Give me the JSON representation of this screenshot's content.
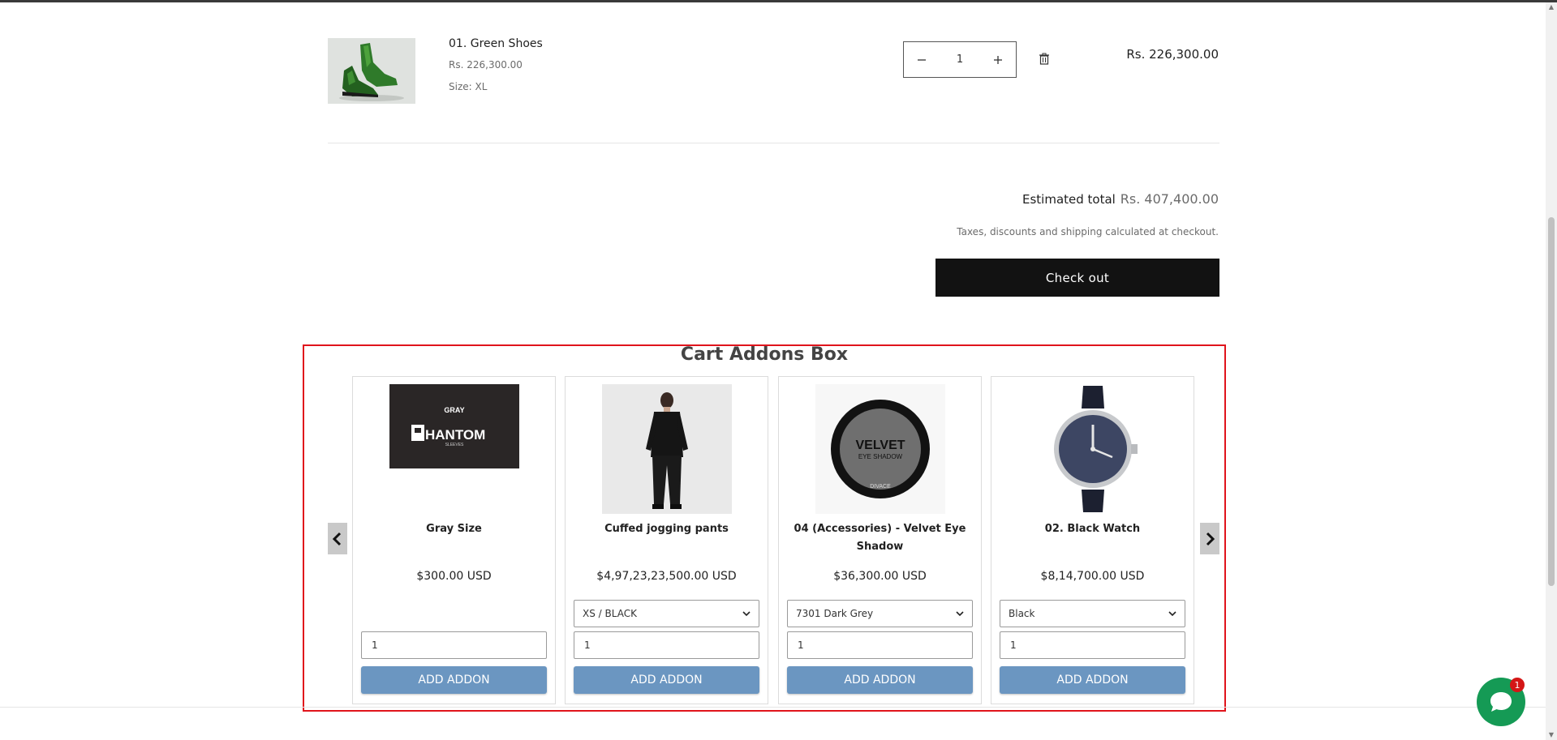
{
  "cart_item": {
    "name": "01. Green Shoes",
    "price": "Rs. 226,300.00",
    "size": "Size: XL",
    "quantity": "1",
    "line_total": "Rs. 226,300.00",
    "decrease_icon": "minus-icon",
    "increase_icon": "plus-icon",
    "remove_icon": "trash-icon"
  },
  "summary": {
    "estimated_label": "Estimated total",
    "estimated_value": "Rs. 407,400.00",
    "tax_note": "Taxes, discounts and shipping calculated at checkout.",
    "checkout_label": "Check out"
  },
  "addons": {
    "title": "Cart Addons Box",
    "border_color": "#e0141c",
    "button_color": "#6b96c1",
    "prev_icon": "chevron-left-icon",
    "next_icon": "chevron-right-icon",
    "cards": [
      {
        "title": "Gray Size",
        "price": "$300.00 USD",
        "variant": "",
        "quantity": "1",
        "button": "ADD ADDON",
        "logo_top": "GRAY",
        "logo_main": "HANTOM",
        "logo_sub": "SLEEVES"
      },
      {
        "title": "Cuffed jogging pants",
        "price": "$4,97,23,23,500.00 USD",
        "variant": "XS / BLACK",
        "quantity": "1",
        "button": "ADD ADDON"
      },
      {
        "title": "04 (Accessories) - Velvet Eye Shadow",
        "price": "$36,300.00 USD",
        "variant": "7301 Dark Grey",
        "quantity": "1",
        "button": "ADD ADDON",
        "label_main": "VELVET",
        "label_sub": "EYE SHADOW",
        "label_brand": "DIVACE"
      },
      {
        "title": "02. Black Watch",
        "price": "$8,14,700.00 USD",
        "variant": "Black",
        "quantity": "1",
        "button": "ADD ADDON"
      }
    ]
  },
  "chat": {
    "icon": "chat-bubble-icon",
    "badge": "1",
    "color": "#159a55"
  }
}
